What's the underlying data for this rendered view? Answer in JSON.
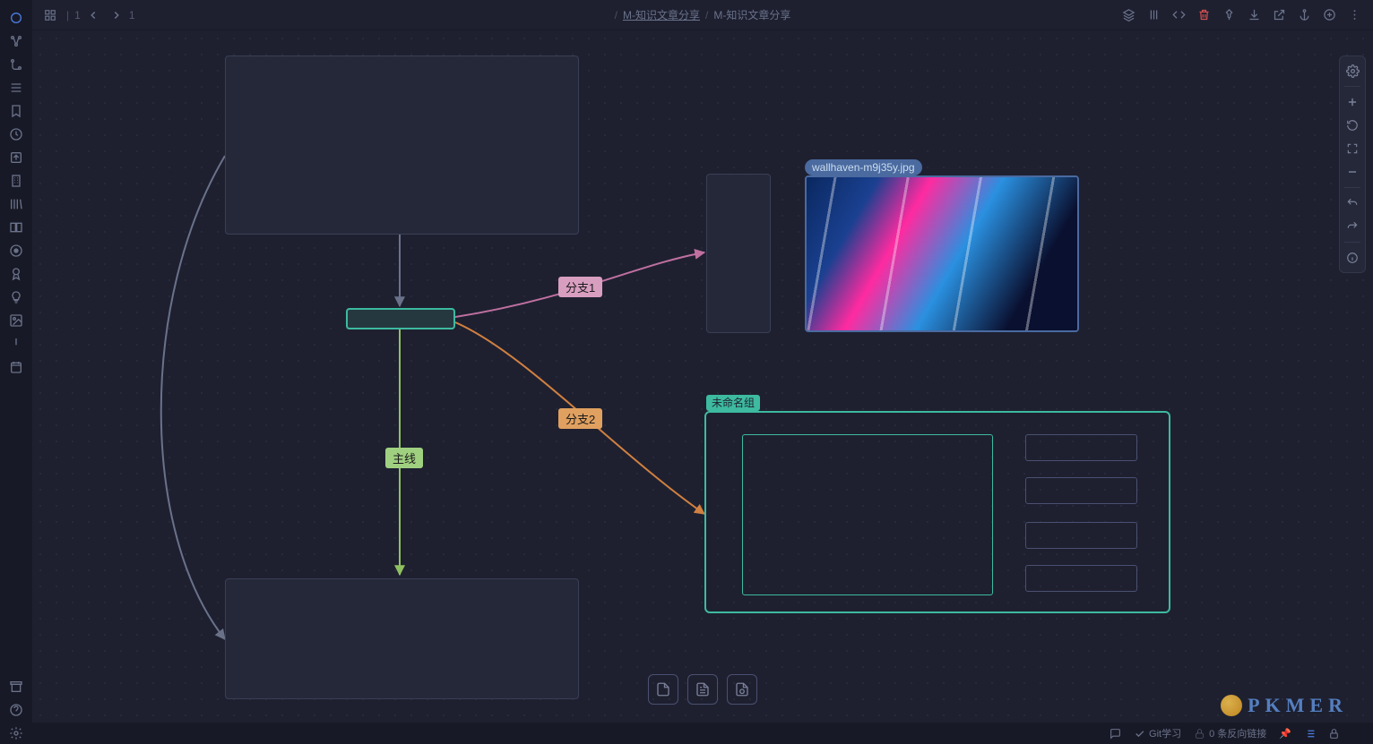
{
  "breadcrumb": {
    "parent": "M-知识文章分享",
    "current": "M-知识文章分享"
  },
  "edges": {
    "main_line": "主线",
    "branch1": "分支1",
    "branch2": "分支2"
  },
  "image_node": {
    "filename": "wallhaven-m9j35y.jpg"
  },
  "group": {
    "label": "未命名组"
  },
  "statusbar": {
    "git_label": "Git学习",
    "backlinks": "0 条反向链接"
  },
  "brand": "PKMER",
  "nav": {
    "back_count": "1",
    "fwd_count": "1"
  }
}
